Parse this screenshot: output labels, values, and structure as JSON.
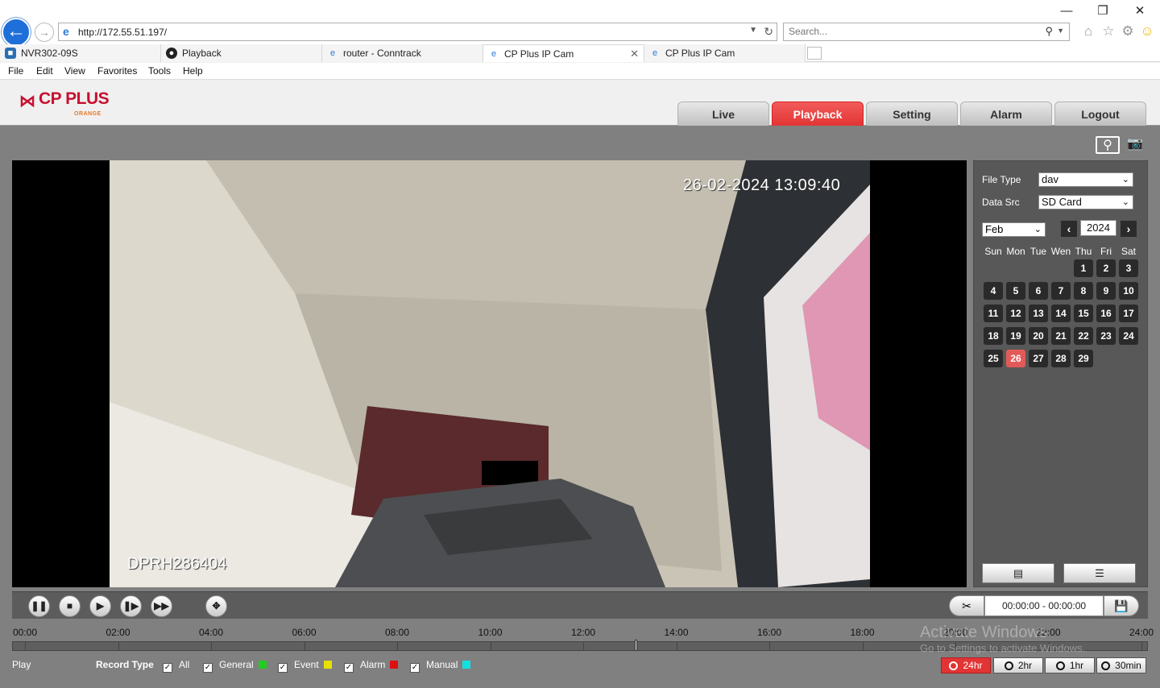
{
  "browser": {
    "url": "http://172.55.51.197/",
    "search_placeholder": "Search...",
    "tabs": [
      {
        "label": "NVR302-09S"
      },
      {
        "label": "Playback"
      },
      {
        "label": "router - Conntrack"
      },
      {
        "label": "CP Plus IP Cam"
      },
      {
        "label": "CP Plus IP Cam"
      }
    ],
    "menu": [
      "File",
      "Edit",
      "View",
      "Favorites",
      "Tools",
      "Help"
    ]
  },
  "app": {
    "logo_text": "CP PLUS",
    "logo_sub": "ORANGE",
    "nav": [
      "Live",
      "Playback",
      "Setting",
      "Alarm",
      "Logout"
    ],
    "active_nav": "Playback"
  },
  "video": {
    "timestamp": "26-02-2024 13:09:40",
    "camera_id": "DPRH286404"
  },
  "controls": {
    "time_range": "00:00:00 - 00:00:00"
  },
  "timeline": {
    "labels": [
      "00:00",
      "02:00",
      "04:00",
      "06:00",
      "08:00",
      "10:00",
      "12:00",
      "14:00",
      "16:00",
      "18:00",
      "20:00",
      "22:00",
      "24:00"
    ],
    "cursor_hour": 13.1
  },
  "status": {
    "play": "Play",
    "record_type_label": "Record Type",
    "record_types": [
      {
        "label": "All",
        "color": ""
      },
      {
        "label": "General",
        "color": "#22cc22"
      },
      {
        "label": "Event",
        "color": "#e8e000"
      },
      {
        "label": "Alarm",
        "color": "#e01010"
      },
      {
        "label": "Manual",
        "color": "#10e0e0"
      }
    ],
    "ranges": [
      "24hr",
      "2hr",
      "1hr",
      "30min"
    ],
    "active_range": "24hr"
  },
  "watermark": {
    "line1": "Activate Windows",
    "line2": "Go to Settings to activate Windows."
  },
  "side_panel": {
    "file_type_label": "File Type",
    "file_type_value": "dav",
    "data_src_label": "Data Src",
    "data_src_value": "SD Card",
    "month": "Feb",
    "year": "2024",
    "weekdays": [
      "Sun",
      "Mon",
      "Tue",
      "Wen",
      "Thu",
      "Fri",
      "Sat"
    ],
    "days_in_month": 29,
    "first_weekday": 4,
    "selected_day": 26
  }
}
